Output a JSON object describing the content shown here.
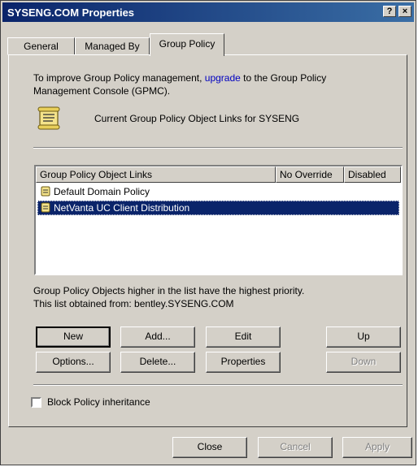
{
  "window": {
    "title": "SYSENG.COM Properties",
    "help_glyph": "?",
    "close_glyph": "×"
  },
  "tabs": [
    "General",
    "Managed By",
    "Group Policy"
  ],
  "intro": {
    "line1_before": "To improve Group Policy management, ",
    "line1_link": "upgrade",
    "line1_after": " to the Group Policy",
    "line2": "Management Console (GPMC)."
  },
  "current_links_label": "Current Group Policy Object Links for SYSENG",
  "list": {
    "columns": [
      "Group Policy Object Links",
      "No Override",
      "Disabled"
    ],
    "rows": [
      {
        "name": "Default Domain Policy",
        "selected": false
      },
      {
        "name": "NetVanta UC Client Distribution",
        "selected": true
      }
    ]
  },
  "notes": {
    "priority": "Group Policy Objects higher in the list have the highest priority.",
    "obtained": "This list obtained from: bentley.SYSENG.COM"
  },
  "buttons": {
    "new": "New",
    "add": "Add...",
    "edit": "Edit",
    "up": "Up",
    "options": "Options...",
    "delete": "Delete...",
    "properties": "Properties",
    "down": "Down"
  },
  "block_inheritance": {
    "label": "Block Policy inheritance",
    "checked": false
  },
  "footer": {
    "close": "Close",
    "cancel": "Cancel",
    "apply": "Apply"
  }
}
